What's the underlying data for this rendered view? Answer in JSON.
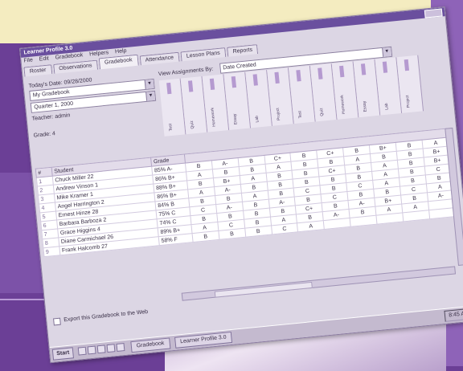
{
  "window": {
    "title": "Learner Profile 3.0"
  },
  "menu": [
    "File",
    "Edit",
    "Gradebook",
    "Helpers",
    "Help"
  ],
  "tabs": [
    "Roster",
    "Observations",
    "Gradebook",
    "Attendance",
    "Lesson Plans",
    "Reports"
  ],
  "panel": {
    "date_label": "Today's Date: 09/28/2000",
    "class_value": "My Gradebook",
    "term_value": "Quarter 1, 2000",
    "teacher_label": "Teacher: admin",
    "grade_label": "Grade: 4"
  },
  "assign_bar": {
    "label": "View Assignments By:",
    "value": "Date Created"
  },
  "assignments": [
    "Test",
    "Quiz",
    "Homework",
    "Essay",
    "Lab",
    "Project",
    "Test",
    "Quiz",
    "Homework",
    "Essay",
    "Lab",
    "Project"
  ],
  "table": {
    "headers": {
      "num": "#",
      "student": "Student",
      "avg": "Grade"
    },
    "rows": [
      {
        "num": "1",
        "name": "Chuck Miller 22",
        "avg": "85% A-",
        "grades": [
          "B",
          "A-",
          "B",
          "C+",
          "B",
          "C+",
          "B",
          "B+",
          "B",
          "A"
        ]
      },
      {
        "num": "2",
        "name": "Andrew Vinson 1",
        "avg": "86% B+",
        "grades": [
          "A",
          "B",
          "B",
          "A",
          "B",
          "B",
          "A",
          "B",
          "B",
          "B+"
        ]
      },
      {
        "num": "3",
        "name": "Mike Kramer 1",
        "avg": "88% B+",
        "grades": [
          "B",
          "B+",
          "A",
          "B",
          "B",
          "C+",
          "B",
          "A",
          "B",
          "B+"
        ]
      },
      {
        "num": "4",
        "name": "Angel Harrington 2",
        "avg": "86% B+",
        "grades": [
          "A",
          "A-",
          "B",
          "B",
          "B",
          "B",
          "B",
          "A",
          "B",
          "C"
        ]
      },
      {
        "num": "5",
        "name": "Ernest Hinze 28",
        "avg": "84% B",
        "grades": [
          "B",
          "B",
          "A",
          "B",
          "C",
          "B",
          "C",
          "A",
          "B",
          "B"
        ]
      },
      {
        "num": "6",
        "name": "Barbara Barboza 2",
        "avg": "75% C",
        "grades": [
          "C",
          "A-",
          "B",
          "A-",
          "B",
          "C",
          "B",
          "B",
          "C",
          "A"
        ]
      },
      {
        "num": "7",
        "name": "Grace Higgins 4",
        "avg": "74% C",
        "grades": [
          "B",
          "B",
          "B",
          "B",
          "C+",
          "B",
          "A-",
          "B+",
          "B",
          "A-"
        ]
      },
      {
        "num": "8",
        "name": "Diane Carmichael 26",
        "avg": "89% B+",
        "grades": [
          "A",
          "C",
          "B",
          "A",
          "B",
          "A-",
          "B",
          "A",
          "A",
          ""
        ]
      },
      {
        "num": "9",
        "name": "Frank Halcomb 27",
        "avg": "58% F",
        "grades": [
          "B",
          "B",
          "B",
          "C",
          "A",
          "",
          "",
          "",
          "",
          ""
        ]
      }
    ]
  },
  "footer": {
    "checkbox_label": "Export this Gradebook to the Web"
  },
  "taskbar": {
    "start": "Start",
    "task1": "Gradebook",
    "task2": "Learner Profile 3.0",
    "clock": "8:45 AM"
  }
}
